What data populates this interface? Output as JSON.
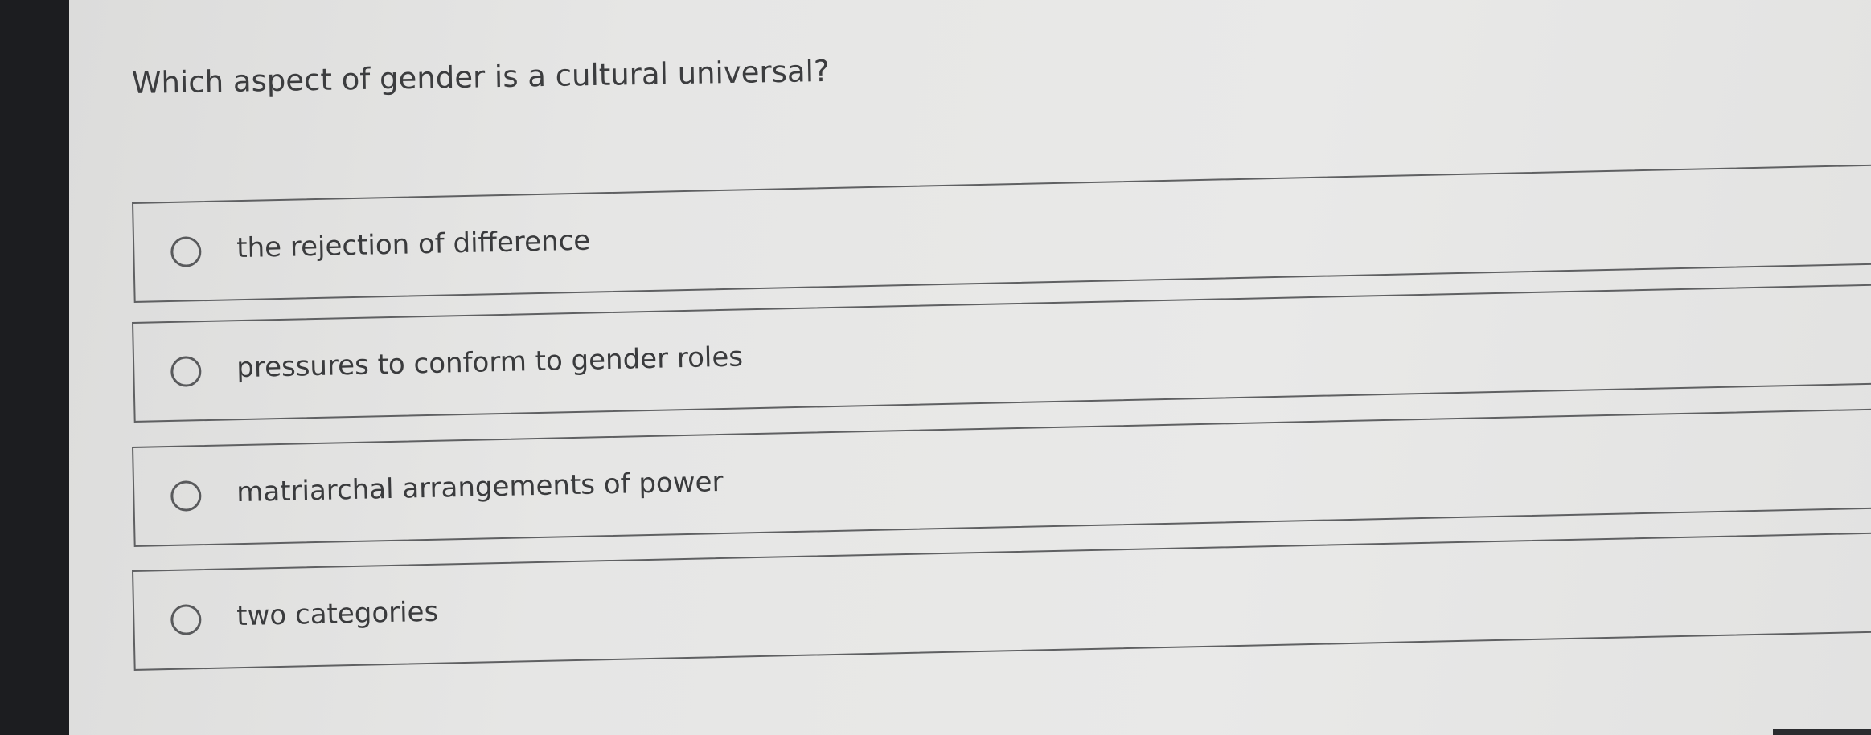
{
  "question": {
    "text": "Which aspect of gender is a cultural universal?"
  },
  "options": [
    {
      "label": "the rejection of difference"
    },
    {
      "label": "pressures to conform to gender roles"
    },
    {
      "label": "matriarchal arrangements of power"
    },
    {
      "label": "two categories"
    }
  ],
  "colors": {
    "background": "#e7e7e6",
    "text": "#3c3d3f",
    "border": "#5f6062",
    "bezel": "#1c1d20"
  },
  "icons": {
    "radio": "radio-circle-unselected"
  }
}
